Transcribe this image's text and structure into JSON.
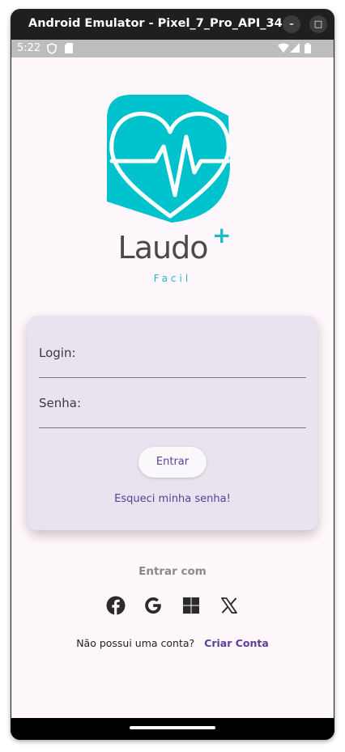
{
  "window": {
    "title": "Android Emulator - Pixel_7_Pro_API_34...",
    "minimize_icon": "minimize-icon",
    "close_icon": "close-icon"
  },
  "status_bar": {
    "time": "5:22",
    "icons": [
      "shield-icon",
      "sd-card-icon",
      "wifi-icon",
      "signal-icon",
      "battery-icon"
    ]
  },
  "brand": {
    "name": "Laudo",
    "plus": "+",
    "subtitle": "Facil",
    "accent_color": "#1fb9c2"
  },
  "login_card": {
    "login_label": "Login:",
    "password_label": "Senha:",
    "submit_label": "Entrar",
    "forgot_link": "Esqueci minha senha!"
  },
  "social": {
    "title": "Entrar com",
    "providers": [
      "facebook-icon",
      "google-icon",
      "windows-icon",
      "x-icon"
    ]
  },
  "signup": {
    "question": "Não possui uma conta?",
    "link": "Criar Conta"
  },
  "colors": {
    "primary": "#5a3f96",
    "card_bg": "#e8e3ee",
    "screen_bg": "#fef7fb"
  }
}
